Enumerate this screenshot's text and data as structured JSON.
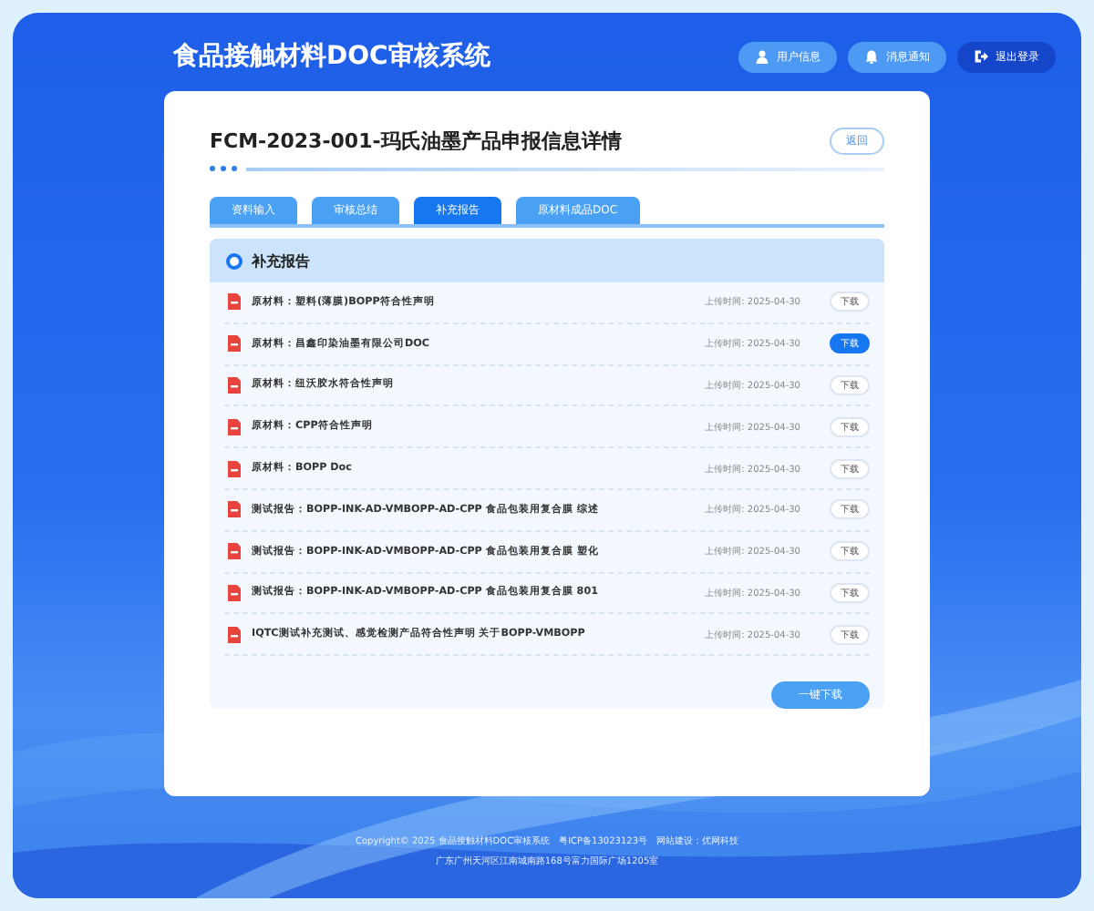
{
  "header": {
    "title": "食品接触材料DOC审核系统",
    "buttons": [
      {
        "label": "用户信息",
        "kind": "user"
      },
      {
        "label": "消息通知",
        "kind": "bell"
      },
      {
        "label": "退出登录",
        "kind": "logout"
      }
    ]
  },
  "page": {
    "title": "FCM-2023-001-玛氏油墨产品申报信息详情",
    "back": "返回"
  },
  "tabs": [
    {
      "label": "资料输入",
      "selected": false
    },
    {
      "label": "审核总结",
      "selected": false
    },
    {
      "label": "补充报告",
      "selected": true
    },
    {
      "label": "原材料成品DOC",
      "selected": false
    }
  ],
  "section": {
    "title": "补充报告",
    "files": [
      {
        "name": "原材料：塑料(薄膜)BOPP符合性声明",
        "time": "上传时间: 2025-04-30",
        "action": "下载",
        "selected": false
      },
      {
        "name": "原材料：昌鑫印染油墨有限公司DOC",
        "time": "上传时间: 2025-04-30",
        "action": "下载",
        "selected": true
      },
      {
        "name": "原材料：纽沃胶水符合性声明",
        "time": "上传时间: 2025-04-30",
        "action": "下载",
        "selected": false
      },
      {
        "name": "原材料：CPP符合性声明",
        "time": "上传时间: 2025-04-30",
        "action": "下载",
        "selected": false
      },
      {
        "name": "原材料：BOPP Doc",
        "time": "上传时间: 2025-04-30",
        "action": "下载",
        "selected": false
      },
      {
        "name": "测试报告：BOPP-INK-AD-VMBOPP-AD-CPP 食品包装用复合膜 综述",
        "time": "上传时间: 2025-04-30",
        "action": "下载",
        "selected": false
      },
      {
        "name": "测试报告：BOPP-INK-AD-VMBOPP-AD-CPP 食品包装用复合膜 塑化",
        "time": "上传时间: 2025-04-30",
        "action": "下载",
        "selected": false
      },
      {
        "name": "测试报告：BOPP-INK-AD-VMBOPP-AD-CPP 食品包装用复合膜 801",
        "time": "上传时间: 2025-04-30",
        "action": "下载",
        "selected": false
      },
      {
        "name": "IQTC测试补充测试、感觉检测产品符合性声明 关于BOPP-VMBOPP",
        "time": "上传时间: 2025-04-30",
        "action": "下载",
        "selected": false
      }
    ],
    "download_all": "一键下载"
  },
  "footer": [
    "Copyright© 2025 食品接触材料DOC审核系统　粤ICP备13023123号　网站建设：优网科技",
    "广东广州天河区江南城南路168号富力国际广场1205室"
  ]
}
